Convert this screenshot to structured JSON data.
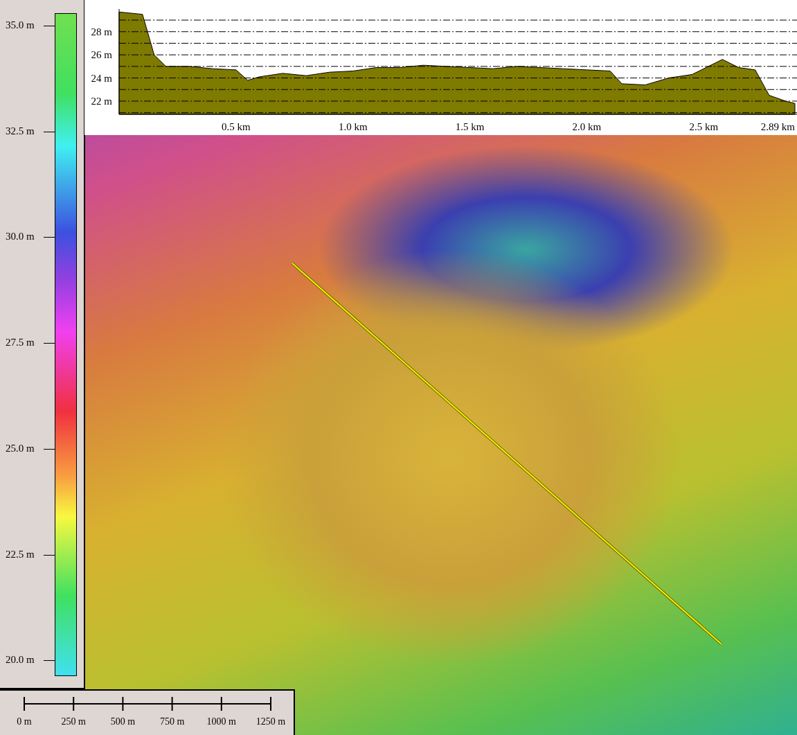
{
  "elevation_legend": {
    "labels": [
      "35.0 m",
      "32.5 m",
      "30.0 m",
      "27.5 m",
      "25.0 m",
      "22.5 m",
      "20.0 m"
    ]
  },
  "elevation_profile": {
    "chart_data": {
      "type": "area",
      "x": [
        0,
        0.1,
        0.15,
        0.2,
        0.3,
        0.4,
        0.5,
        0.55,
        0.6,
        0.7,
        0.8,
        0.9,
        1.0,
        1.1,
        1.2,
        1.3,
        1.4,
        1.5,
        1.6,
        1.7,
        1.8,
        1.9,
        2.0,
        2.1,
        2.15,
        2.25,
        2.35,
        2.45,
        2.5,
        2.58,
        2.65,
        2.72,
        2.78,
        2.85,
        2.89
      ],
      "grid": true,
      "series": [
        {
          "color": "#7f7a00",
          "values": [
            29.7,
            29.5,
            26.0,
            25.0,
            25.0,
            24.8,
            24.7,
            23.8,
            24.1,
            24.4,
            24.2,
            24.5,
            24.6,
            24.9,
            24.9,
            25.1,
            25.0,
            24.9,
            24.8,
            25.0,
            24.9,
            24.8,
            24.7,
            24.6,
            23.5,
            23.4,
            24.0,
            24.3,
            24.8,
            25.6,
            24.9,
            24.7,
            22.5,
            22.0,
            21.8
          ]
        }
      ],
      "xlim": [
        0,
        2.89
      ],
      "ylim": [
        20.86,
        29.84
      ],
      "xticks": [
        {
          "value": 0.5,
          "label": "0.5 km"
        },
        {
          "value": 1.0,
          "label": "1.0 km"
        },
        {
          "value": 1.5,
          "label": "1.5 km"
        },
        {
          "value": 2.0,
          "label": "2.0 km"
        },
        {
          "value": 2.5,
          "label": "2.5 km"
        },
        {
          "value": 2.89,
          "label": "2.89 km"
        }
      ],
      "yticks": [
        {
          "value": 22,
          "label": "22 m"
        },
        {
          "value": 24,
          "label": "24 m"
        },
        {
          "value": 26,
          "label": "26 m"
        },
        {
          "value": 28,
          "label": "28 m"
        }
      ]
    }
  },
  "scale_bar": {
    "labels": [
      "0 m",
      "250 m",
      "500 m",
      "750 m",
      "1000 m",
      "1250 m"
    ]
  }
}
